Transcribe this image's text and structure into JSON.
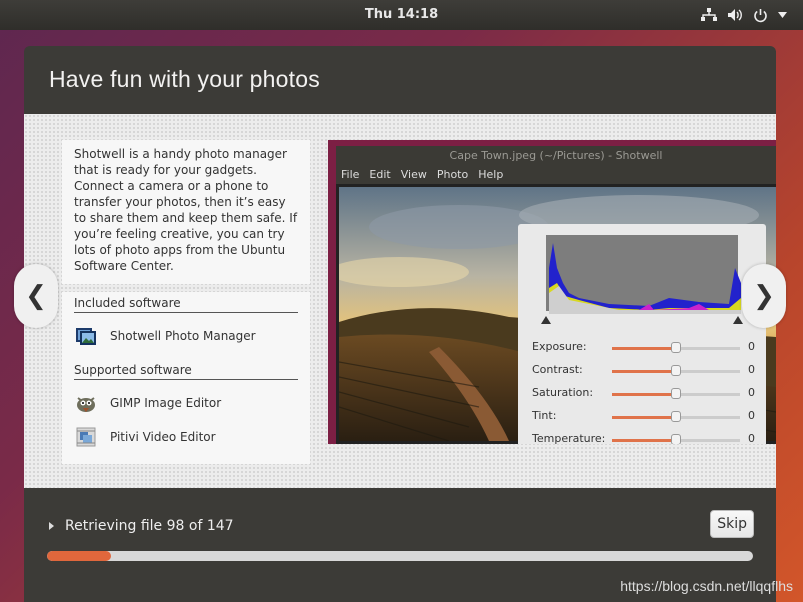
{
  "topbar": {
    "clock": "Thu 14:18",
    "icons": [
      "network-icon",
      "volume-icon",
      "power-icon",
      "chevron-down-icon"
    ]
  },
  "window": {
    "title": "Have fun with your photos",
    "description": "Shotwell is a handy photo manager that is ready for your gadgets. Connect a camera or a phone to transfer your photos, then it’s easy to share them and keep them safe. If you’re feeling creative, you can try lots of photo apps from the Ubuntu Software Center.",
    "included": {
      "title": "Included software",
      "apps": [
        {
          "name": "Shotwell Photo Manager",
          "icon": "shotwell-icon"
        }
      ]
    },
    "supported": {
      "title": "Supported software",
      "apps": [
        {
          "name": "GIMP Image Editor",
          "icon": "gimp-icon"
        },
        {
          "name": "Pitivi Video Editor",
          "icon": "pitivi-icon"
        }
      ]
    },
    "nav": {
      "prev": "❮",
      "next": "❯"
    }
  },
  "shotwell": {
    "window_title": "Cape Town.jpeg (~/Pictures) - Shotwell",
    "menu": [
      "File",
      "Edit",
      "View",
      "Photo",
      "Help"
    ],
    "adjustments": [
      {
        "label": "Exposure:",
        "value": "0",
        "level": 0.5
      },
      {
        "label": "Contrast:",
        "value": "0",
        "level": 0.5
      },
      {
        "label": "Saturation:",
        "value": "0",
        "level": 0.5
      },
      {
        "label": "Tint:",
        "value": "0",
        "level": 0.5
      },
      {
        "label": "Temperature:",
        "value": "0",
        "level": 0.5
      }
    ]
  },
  "footer": {
    "status": "Retrieving file 98 of 147",
    "progress": 0.09,
    "skip_label": "Skip",
    "accent": "#e0673c"
  },
  "watermark": "https://blog.csdn.net/llqqflhs"
}
